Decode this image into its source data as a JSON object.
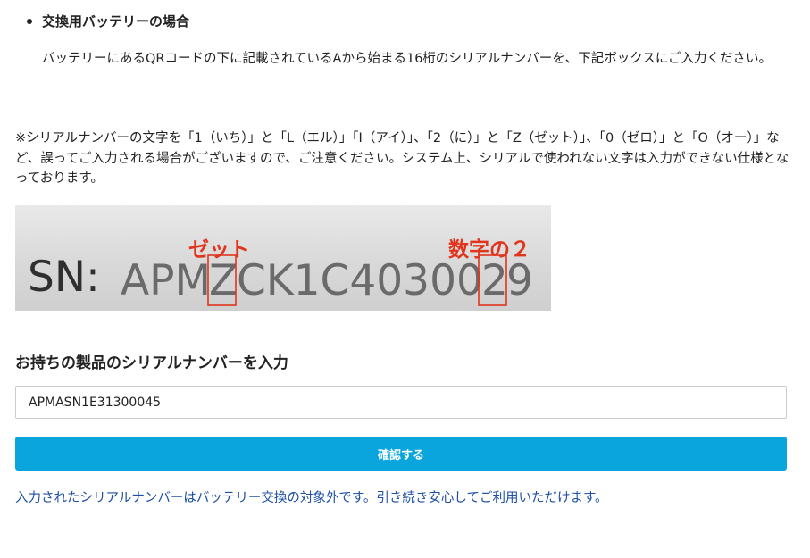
{
  "heading": "交換用バッテリーの場合",
  "intro": "バッテリーにあるQRコードの下に記載されているAから始まる16桁のシリアルナンバーを、下記ボックスにご入力ください。",
  "note": "※シリアルナンバーの文字を「1（いち）」と「L（エル）」「I（アイ）」、「2（に）」と「Z（ゼット）」、「0（ゼロ）」と「O（オー）」など、誤ってご入力される場合がございますので、ご注意ください。システム上、シリアルで使われない文字は入力ができない仕様となっております。",
  "sample_image": {
    "sn_label": "SN:",
    "serial_prefix": "APM",
    "serial_z": "Z",
    "serial_mid": "CK1C40300",
    "serial_two": "2",
    "serial_end": "9",
    "annotation_z": "ゼット",
    "annotation_2": "数字の２",
    "annotation_color": "#e0351c"
  },
  "form": {
    "title": "お持ちの製品のシリアルナンバーを入力",
    "input_value": "APMASN1E31300045",
    "confirm_label": "確認する"
  },
  "result_message": "入力されたシリアルナンバーはバッテリー交換の対象外です。引き続き安心してご利用いただけます。",
  "colors": {
    "button": "#0aa5dd",
    "result_text": "#1d4fa3"
  }
}
